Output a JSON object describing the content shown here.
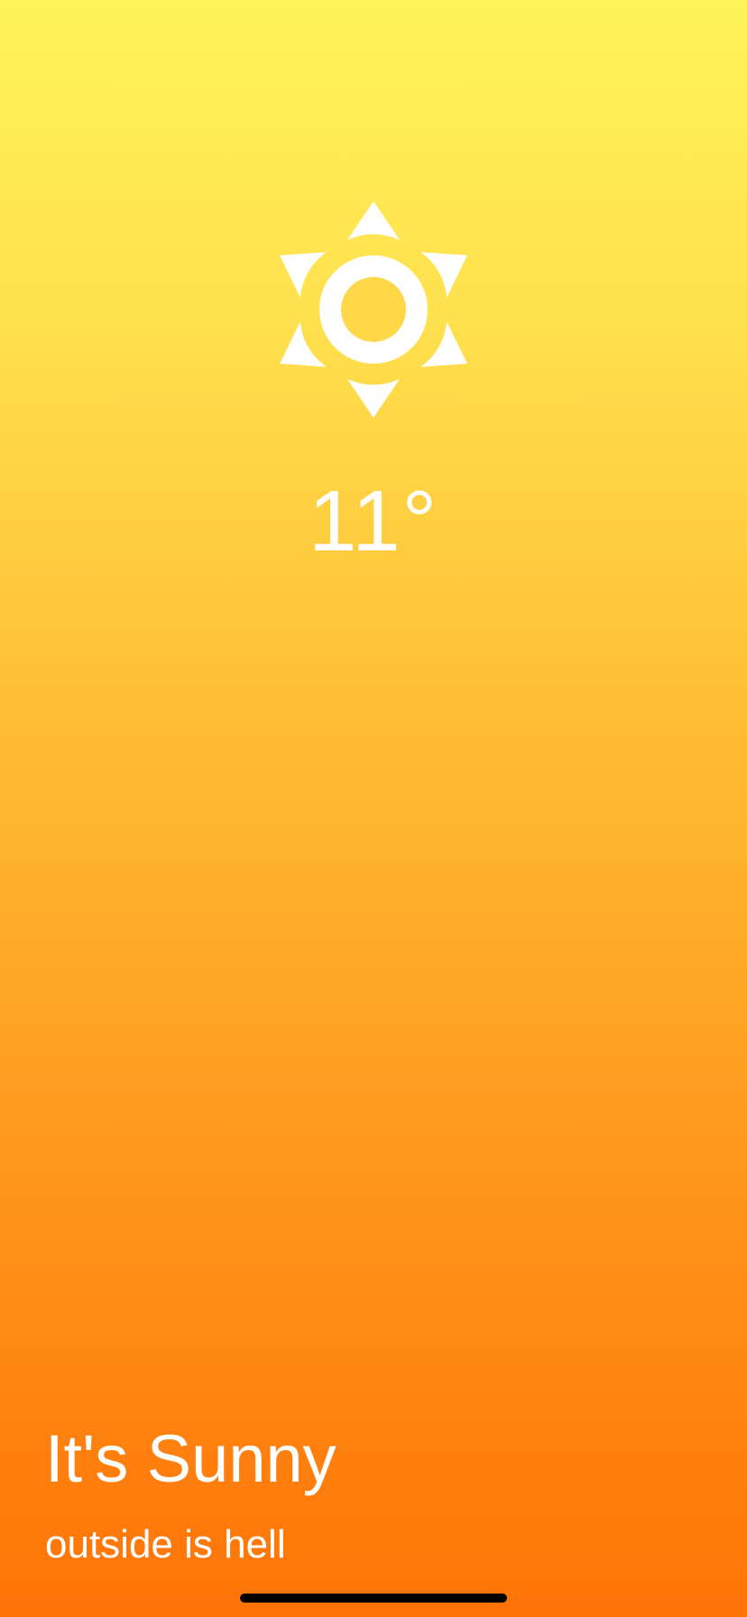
{
  "weather": {
    "icon": "sun-icon",
    "temperature": "11°",
    "condition_title": "It's Sunny",
    "condition_subtitle": "outside is hell"
  },
  "colors": {
    "gradient_top": "#fff45c",
    "gradient_bottom": "#ff7307",
    "text": "#ffffff",
    "home_indicator": "#000000"
  }
}
